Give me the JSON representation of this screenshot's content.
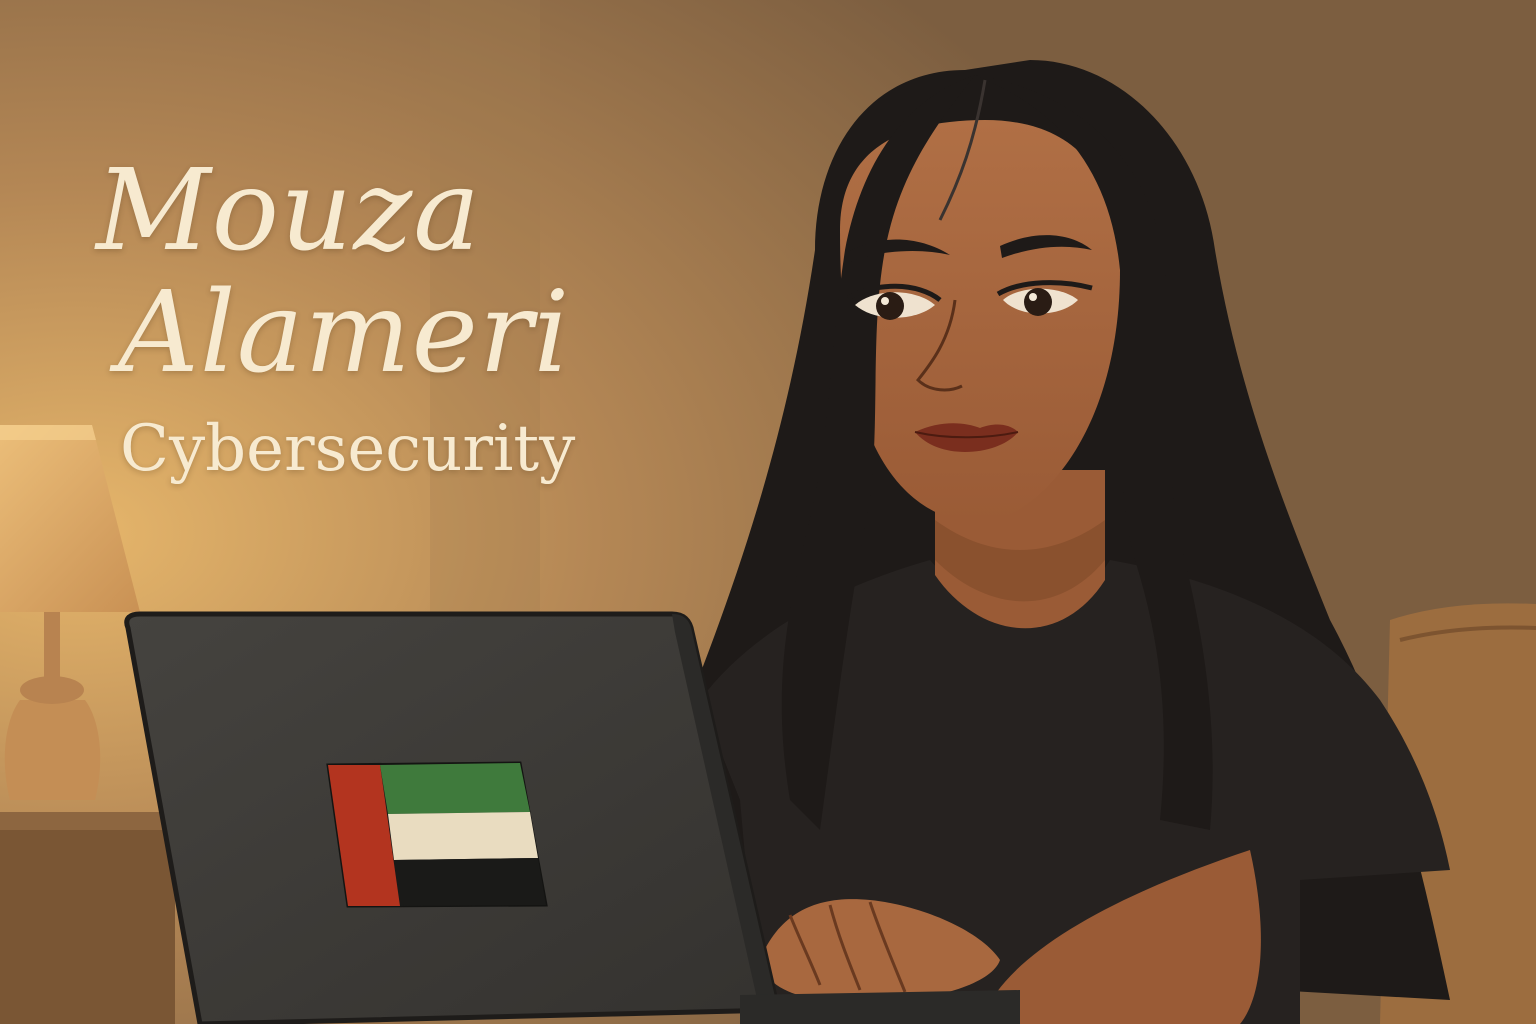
{
  "poster": {
    "name_first": "Mouza",
    "name_last": "Alameri",
    "field": "Cybersecurity"
  },
  "colors": {
    "wall": "#b08a5c",
    "lamp_glow": "#e0b26a",
    "hair": "#1e1a18",
    "skin": "#a8683f",
    "shirt": "#262220",
    "laptop": "#3a3937",
    "text": "#f7ead0",
    "flag_red": "#b3341f",
    "flag_green": "#3f7a3c",
    "flag_white": "#e9dcc0",
    "flag_black": "#1a1a18"
  },
  "icons": {
    "laptop_sticker": "uae-flag-icon"
  }
}
